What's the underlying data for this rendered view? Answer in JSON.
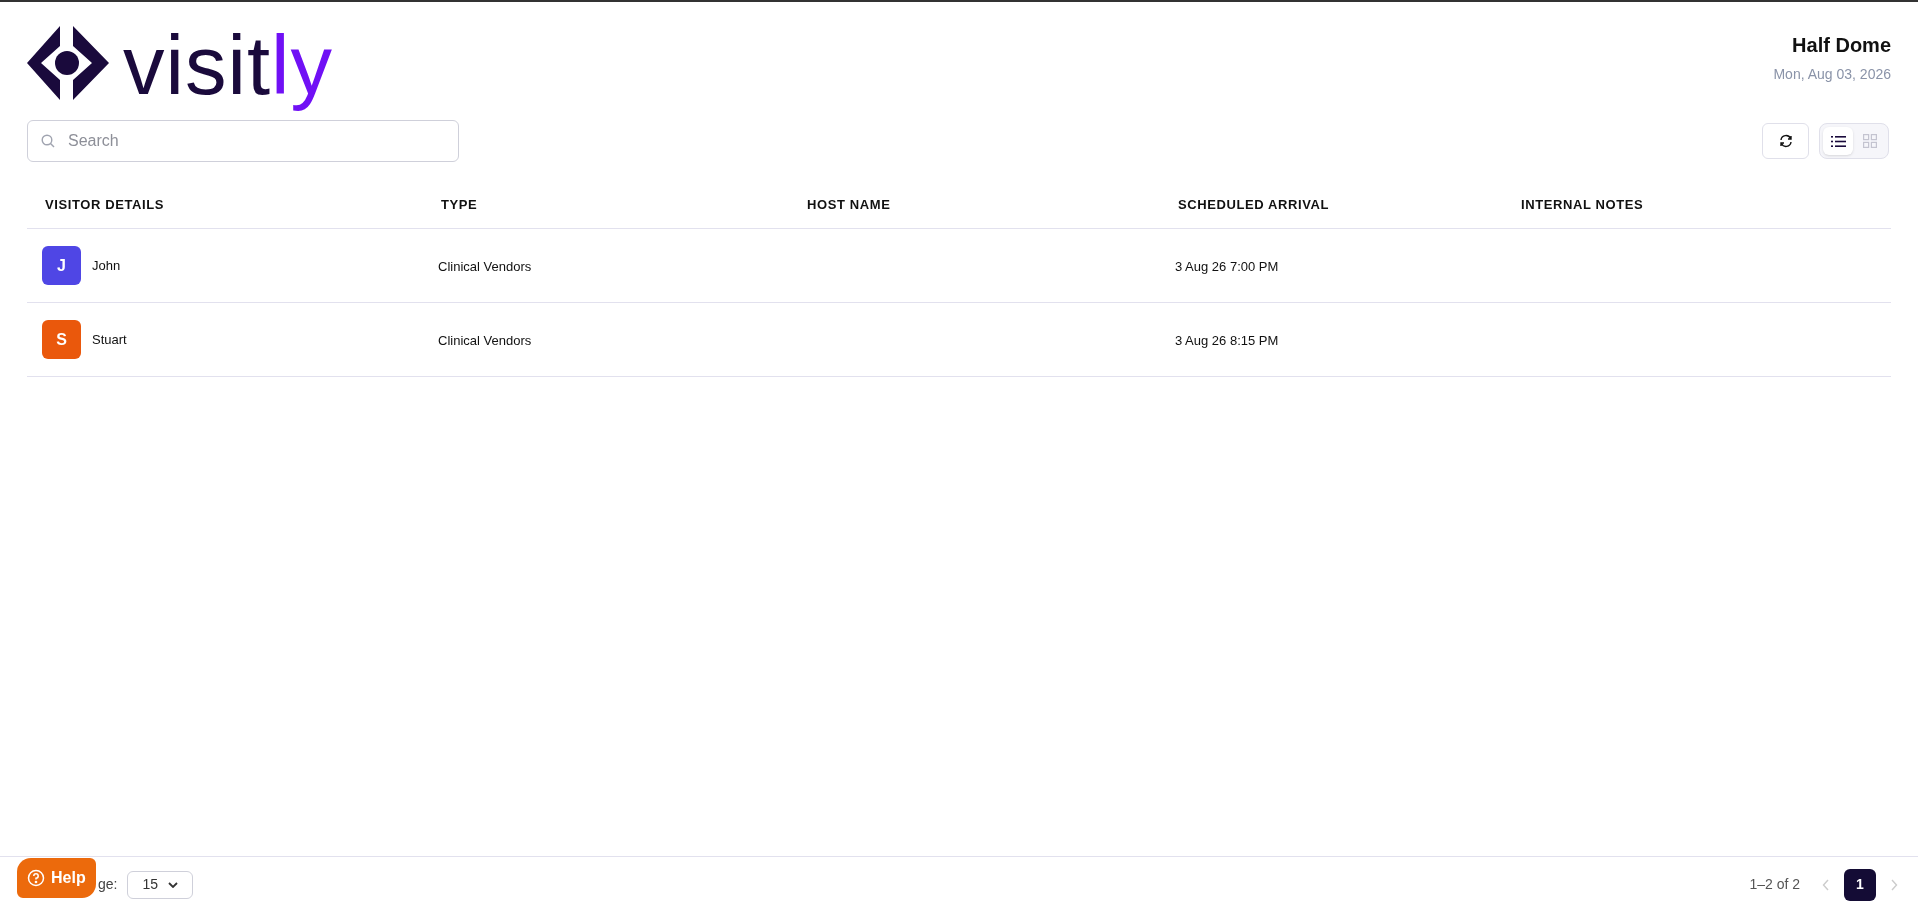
{
  "logo": {
    "parts": [
      "visit",
      "ly"
    ]
  },
  "location": {
    "name": "Half Dome",
    "date": "Mon, Aug 03, 2026"
  },
  "search": {
    "placeholder": "Search"
  },
  "view_toggle": [
    {
      "kind": "list",
      "selected": true
    },
    {
      "kind": "grid",
      "selected": false
    }
  ],
  "table": {
    "columns": [
      "VISITOR DETAILS",
      "TYPE",
      "HOST NAME",
      "SCHEDULED ARRIVAL",
      "INTERNAL NOTES"
    ],
    "rows": [
      {
        "initial": "J",
        "color": "#4f46e5",
        "name": "John",
        "type": "Clinical Vendors",
        "arrival": "3 Aug 26 7:00 PM"
      },
      {
        "initial": "S",
        "color": "#ea580c",
        "name": "Stuart",
        "type": "Clinical Vendors",
        "arrival": "3 Aug 26 8:15 PM"
      }
    ]
  },
  "footer": {
    "rows_per_page_label": "ge:",
    "rows_per_page": "15",
    "range": "1–2 of 2",
    "pages": [
      {
        "label": "1",
        "selected": true
      }
    ]
  },
  "help_button": {
    "label": "Help"
  }
}
